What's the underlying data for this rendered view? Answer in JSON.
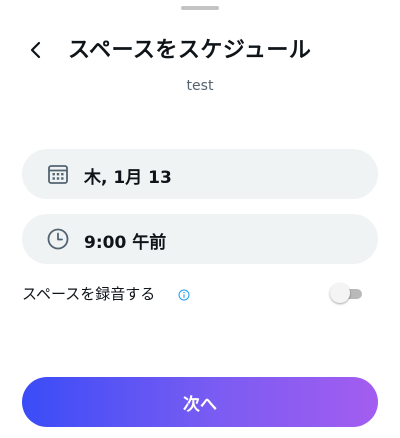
{
  "header": {
    "title": "スペースをスケジュール",
    "back_icon": "chevron-left-icon"
  },
  "space_name": "test",
  "date_field": {
    "icon": "calendar-icon",
    "value": "木, 1月 13"
  },
  "time_field": {
    "icon": "clock-icon",
    "value": "9:00 午前"
  },
  "record_option": {
    "label": "スペースを録音する",
    "info_icon": "info-icon",
    "enabled": false
  },
  "next_button": {
    "label": "次へ"
  },
  "colors": {
    "accent_start": "#3a4cf7",
    "accent_end": "#a35df0",
    "field_background": "#eff3f4",
    "info_icon": "#1d9bf0"
  }
}
